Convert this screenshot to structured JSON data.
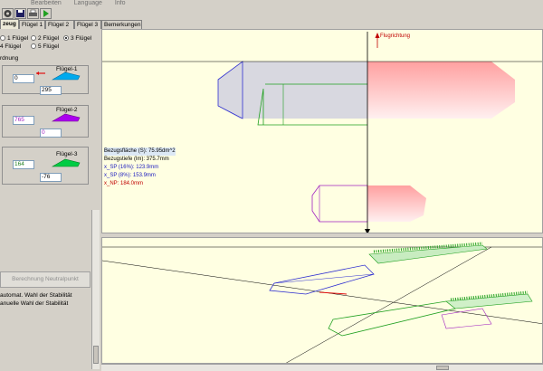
{
  "menu": [
    "",
    "Bearbeiten",
    "Language",
    "Info"
  ],
  "tabs": [
    "zeug",
    "Flügel 1",
    "Flügel 2",
    "Flügel 3",
    "Bemerkungen"
  ],
  "wing_count": {
    "options": [
      "1 Flügel",
      "2 Flügel",
      "3 Flügel",
      "4 Flügel",
      "5 Flügel"
    ],
    "selected": "3 Flügel"
  },
  "group_title": "rdnung",
  "wings": [
    {
      "label": "Flügel-1",
      "x": "0",
      "y": "295",
      "color": "#00aaee"
    },
    {
      "label": "Flügel-2",
      "x": "765",
      "y": "0",
      "color": "#aa00ee"
    },
    {
      "label": "Flügel-3",
      "x": "164",
      "y": "-76",
      "color": "#00cc44"
    }
  ],
  "calc_button": "Berechnung Neutralpunkt",
  "stability_options": [
    "automat. Wahl der Stabilität",
    "anuelle Wahl der Stabilität"
  ],
  "flight_direction": "Flugrichtung",
  "info": {
    "area": "Bezugsfläche (S): 75.95dm^2",
    "depth": "Bezugstiefe (lm): 375.7mm",
    "xsp16": "x_SP (16%): 123.9mm",
    "xsp8": "x_SP (8%): 153.9mm",
    "xnp": "x_NP: 184.0mm"
  },
  "colors": {
    "info_blue": "#2020c0",
    "info_red": "#c00000",
    "wing_blue": "#3030d0",
    "wing_green": "#20a020",
    "wing_purple": "#a020c0",
    "canvas": "#ffffe2"
  }
}
